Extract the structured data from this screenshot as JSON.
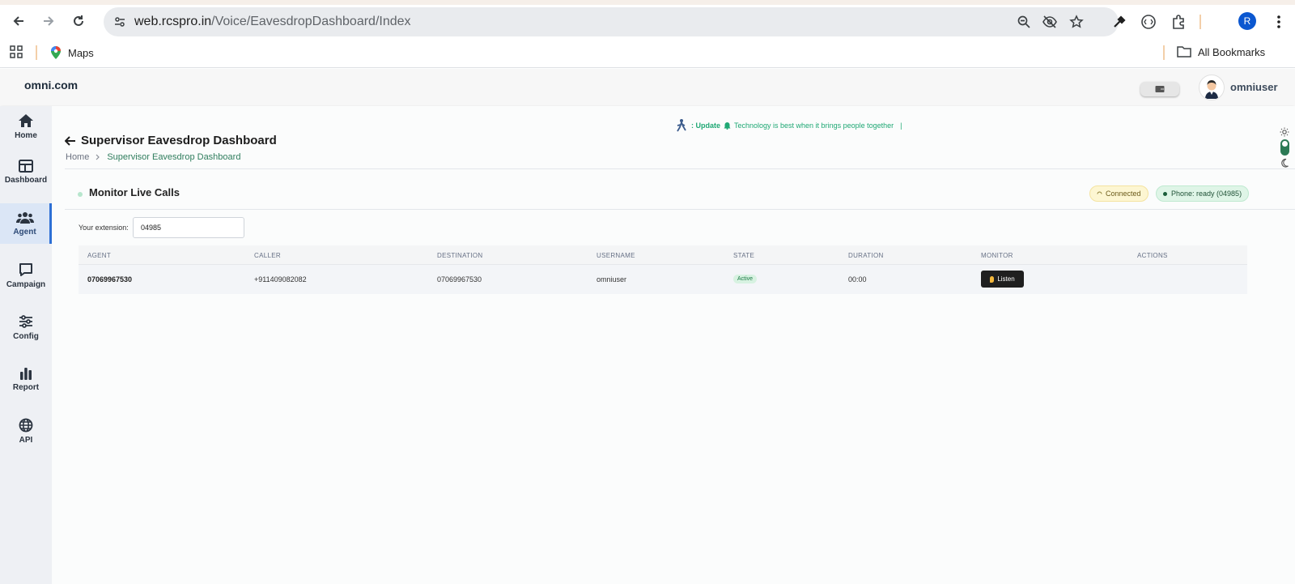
{
  "browser": {
    "url_host": "web.rcspro.in",
    "url_path": "/Voice/EavesdropDashboard/Index",
    "profile_initial": "R",
    "bookmarks": [
      {
        "label": "Maps"
      }
    ],
    "all_bookmarks_label": "All Bookmarks"
  },
  "header": {
    "brand": "omni.com",
    "username": "omniuser"
  },
  "sidebar": {
    "items": [
      {
        "label": "Home",
        "icon": "home-icon"
      },
      {
        "label": "Dashboard",
        "icon": "dashboard-icon"
      },
      {
        "label": "Agent",
        "icon": "users-icon",
        "active": true
      },
      {
        "label": "Campaign",
        "icon": "chat-icon"
      },
      {
        "label": "Config",
        "icon": "sliders-icon"
      },
      {
        "label": "Report",
        "icon": "bar-chart-icon"
      },
      {
        "label": "API",
        "icon": "globe-icon"
      }
    ]
  },
  "ticker": {
    "prefix": ": Update",
    "message": "Technology is best when it brings people together",
    "suffix": "|"
  },
  "page": {
    "title": "Supervisor Eavesdrop Dashboard",
    "breadcrumb_home": "Home",
    "breadcrumb_current": "Supervisor Eavesdrop Dashboard"
  },
  "panel": {
    "title": "Monitor Live Calls",
    "connection_status": "Connected",
    "phone_status": "Phone: ready (04985)"
  },
  "extension": {
    "label": "Your extension:",
    "value": "04985"
  },
  "table": {
    "headers": [
      "AGENT",
      "CALLER",
      "DESTINATION",
      "USERNAME",
      "STATE",
      "DURATION",
      "MONITOR",
      "ACTIONS"
    ],
    "rows": [
      {
        "agent": "07069967530",
        "caller": "+911409082082",
        "destination": "07069967530",
        "username": "omniuser",
        "state": "Active",
        "duration": "00:00",
        "monitor_label": "Listen"
      }
    ]
  },
  "colors": {
    "accent_green": "#2f7d5d",
    "active_sidebar": "#2d6fd5",
    "ticker_green": "#1fa874"
  }
}
